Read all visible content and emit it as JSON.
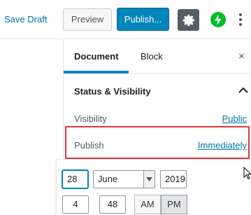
{
  "toolbar": {
    "save_draft": "Save Draft",
    "preview": "Preview",
    "publish": "Publish..."
  },
  "sidebar": {
    "tabs": [
      {
        "label": "Document",
        "active": true
      },
      {
        "label": "Block",
        "active": false
      }
    ],
    "close_symbol": "×",
    "panel": {
      "title": "Status & Visibility",
      "rows": [
        {
          "label": "Visibility",
          "value": "Public"
        },
        {
          "label": "Publish",
          "value": "Immediately"
        }
      ]
    }
  },
  "date_picker": {
    "day": "28",
    "month": "June",
    "year": "2019",
    "hour": "4",
    "time_separator": ":",
    "minute": "48",
    "am_label": "AM",
    "pm_label": "PM",
    "selected_period": "PM"
  },
  "colors": {
    "accent": "#0085ba",
    "link": "#0073aa",
    "highlight": "#e0373e",
    "jetpack": "#00be28"
  }
}
